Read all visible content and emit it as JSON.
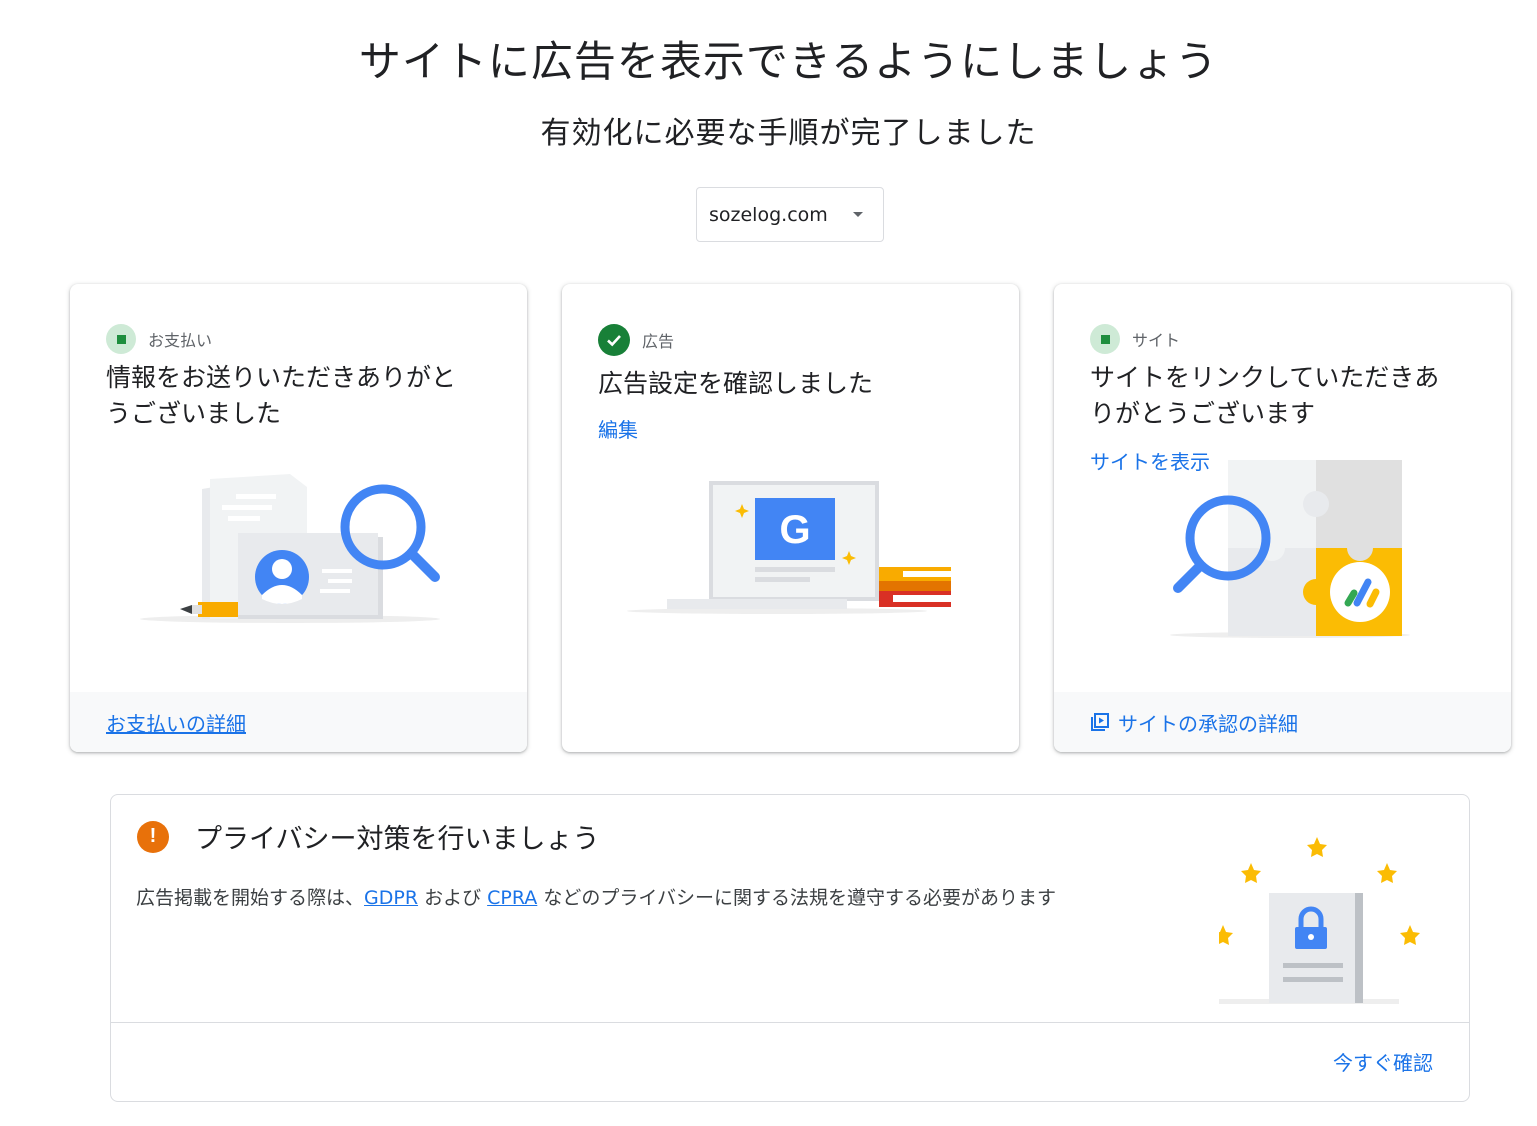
{
  "header": {
    "title": "サイトに広告を表示できるようにしましょう",
    "subtitle": "有効化に必要な手順が完了しました"
  },
  "site_selector": {
    "value": "sozelog.com"
  },
  "cards": [
    {
      "status": "お支払い",
      "headline_line1": "情報をお送りいただきありがと",
      "headline_line2": "うございました",
      "footer_link": "お支払いの詳細"
    },
    {
      "status": "広告",
      "headline": "広告設定を確認しました",
      "link": "編集"
    },
    {
      "status": "サイト",
      "headline_line1": "サイトをリンクしていただきあ",
      "headline_line2": "りがとうございます",
      "link": "サイトを表示",
      "footer_link": "サイトの承認の詳細"
    }
  ],
  "privacy": {
    "title": "プライバシー対策を行いましょう",
    "text_before": "広告掲載を開始する際は、",
    "link_gdpr": "GDPR",
    "text_mid": " および ",
    "link_cpra": "CPRA",
    "text_after": " などのプライバシーに関する法規を遵守する必要があります",
    "action": "今すぐ確認"
  },
  "colors": {
    "link": "#1a73e8",
    "success_green": "#188038",
    "warning_orange": "#e8710a",
    "google_blue": "#4285f4",
    "yellow": "#fbbc04"
  }
}
